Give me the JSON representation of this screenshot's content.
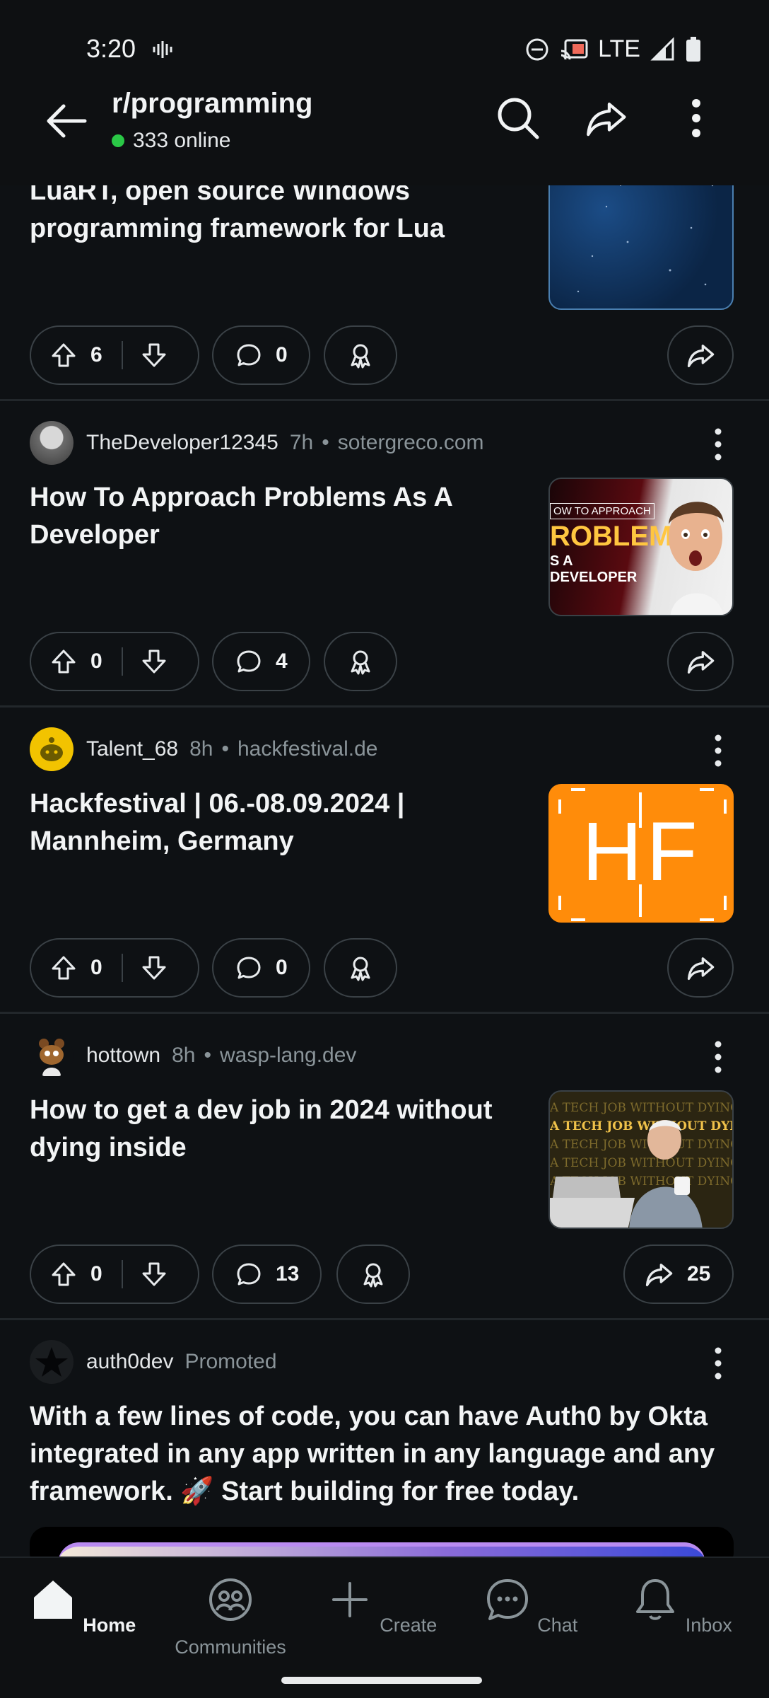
{
  "status_bar": {
    "time": "3:20",
    "network": "LTE"
  },
  "header": {
    "subreddit": "r/programming",
    "online_text": "333 online"
  },
  "posts": [
    {
      "title": "LuaRT, open source Windows programming framework for Lua",
      "upvotes": "6",
      "comments": "0"
    },
    {
      "author": "TheDeveloper12345",
      "age": "7h",
      "domain": "sotergreco.com",
      "title": "How To Approach Problems As A Developer",
      "upvotes": "0",
      "comments": "4",
      "thumb_lines": [
        "OW TO APPROACH",
        "ROBLEMS",
        "S A DEVELOPER"
      ]
    },
    {
      "author": "Talent_68",
      "age": "8h",
      "domain": "hackfestival.de",
      "title": "Hackfestival | 06.-08.09.2024 | Mannheim, Germany",
      "upvotes": "0",
      "comments": "0",
      "thumb_text": "HF"
    },
    {
      "author": "hottown",
      "age": "8h",
      "domain": "wasp-lang.dev",
      "title": "How to get a dev job in 2024 without dying inside",
      "upvotes": "0",
      "comments": "13",
      "shares": "25",
      "thumb_line": "A TECH JOB WITHOUT DYING"
    },
    {
      "author": "auth0dev",
      "promoted_label": "Promoted",
      "title": "With a few lines of code, you can have Auth0 by Okta integrated in any app written in any language and any framework. 🚀 Start building for free today."
    }
  ],
  "nav": {
    "items": [
      {
        "label": "Home",
        "icon": "home-icon"
      },
      {
        "label": "Communities",
        "icon": "communities-icon"
      },
      {
        "label": "Create",
        "icon": "plus-icon"
      },
      {
        "label": "Chat",
        "icon": "chat-icon"
      },
      {
        "label": "Inbox",
        "icon": "bell-icon"
      }
    ]
  },
  "colors": {
    "background": "#0e1114",
    "online_dot": "#2ac846",
    "hf_orange": "#ff8c0a"
  }
}
